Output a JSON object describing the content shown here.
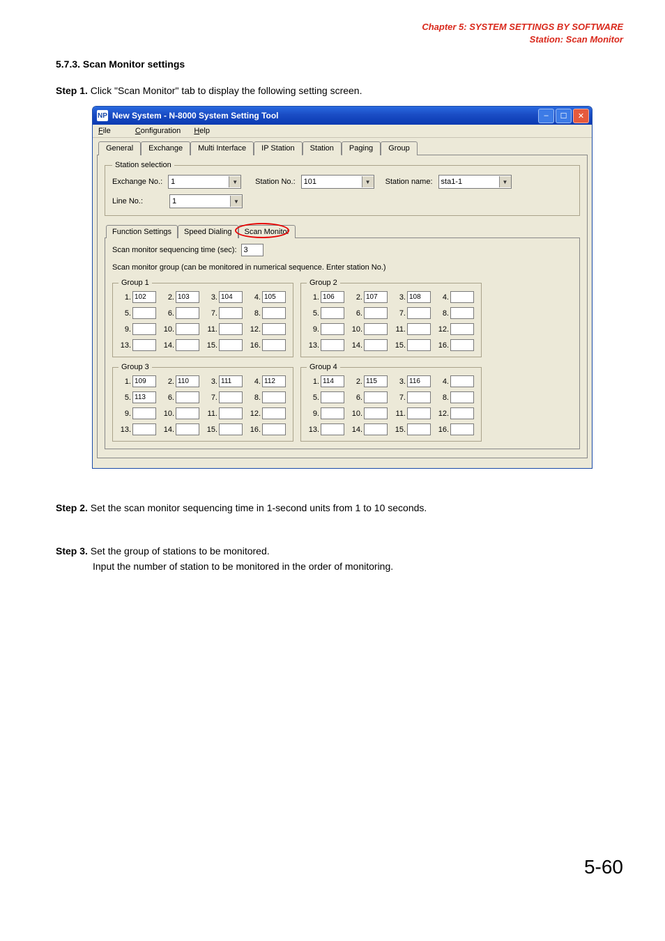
{
  "header": {
    "line1": "Chapter 5:  SYSTEM SETTINGS BY SOFTWARE",
    "line2": "Station: Scan Monitor"
  },
  "section_title": "5.7.3. Scan Monitor settings",
  "step1": {
    "label": "Step 1.",
    "text": "Click \"Scan Monitor\" tab to display the following setting screen."
  },
  "step2": {
    "label": "Step 2.",
    "text": "Set the scan monitor sequencing time in 1-second units from 1 to 10 seconds."
  },
  "step3": {
    "label": "Step 3.",
    "text": "Set the group of stations to be monitored.",
    "sub": "Input the number of station to be monitored in the order of monitoring."
  },
  "page_number": "5-60",
  "window": {
    "title": "New System - N-8000 System Setting Tool",
    "menu": {
      "file": "File",
      "config": "Configuration",
      "help": "Help"
    },
    "tabs": [
      "General",
      "Exchange",
      "Multi Interface",
      "IP Station",
      "Station",
      "Paging",
      "Group"
    ],
    "station_sel": {
      "legend": "Station selection",
      "exchange_lbl": "Exchange No.:",
      "exchange_val": "1",
      "station_no_lbl": "Station No.:",
      "station_no_val": "101",
      "station_name_lbl": "Station name:",
      "station_name_val": "sta1-1",
      "line_no_lbl": "Line No.:",
      "line_no_val": "1"
    },
    "subtabs": [
      "Function Settings",
      "Speed Dialing",
      "Scan Monitor"
    ],
    "seq_label": "Scan monitor sequencing time (sec):",
    "seq_value": "3",
    "group_note": "Scan monitor group (can be monitored in numerical sequence. Enter station No.)",
    "groups": [
      {
        "title": "Group 1",
        "values": [
          "102",
          "103",
          "104",
          "105",
          "",
          "",
          "",
          "",
          "",
          "",
          "",
          "",
          "",
          "",
          "",
          ""
        ]
      },
      {
        "title": "Group 2",
        "values": [
          "106",
          "107",
          "108",
          "",
          "",
          "",
          "",
          "",
          "",
          "",
          "",
          "",
          "",
          "",
          "",
          ""
        ]
      },
      {
        "title": "Group 3",
        "values": [
          "109",
          "110",
          "111",
          "112",
          "113",
          "",
          "",
          "",
          "",
          "",
          "",
          "",
          "",
          "",
          "",
          ""
        ]
      },
      {
        "title": "Group 4",
        "values": [
          "114",
          "115",
          "116",
          "",
          "",
          "",
          "",
          "",
          "",
          "",
          "",
          "",
          "",
          "",
          "",
          ""
        ]
      }
    ]
  }
}
